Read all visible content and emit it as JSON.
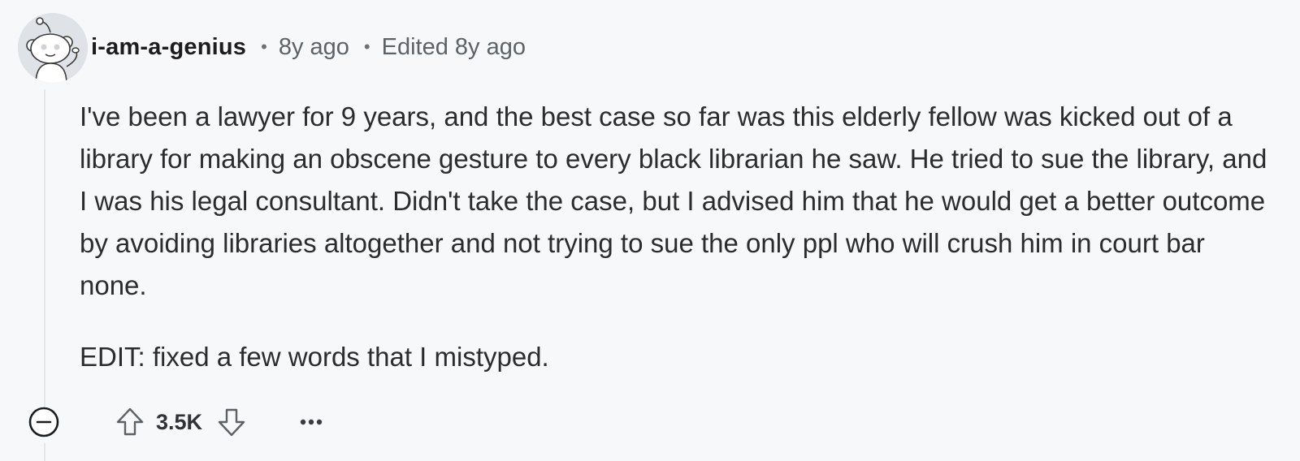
{
  "comment": {
    "author": "i-am-a-genius",
    "separator": "•",
    "age": "8y ago",
    "edited": "Edited 8y ago",
    "body_paragraphs": [
      "I've been a lawyer for 9 years, and the best case so far was this elderly fellow was kicked out of a library for making an obscene gesture to every black librarian he saw. He tried to sue the library, and I was his legal consultant. Didn't take the case, but I advised him that he would get a better outcome by avoiding libraries altogether and not trying to sue the only ppl who will crush him in court bar none.",
      "EDIT: fixed a few words that I mistyped."
    ],
    "score": "3.5K",
    "more_label": "•••"
  },
  "icons": {
    "avatar": "snoo-avatar-icon",
    "collapse": "collapse-minus-icon",
    "upvote": "upvote-arrow-icon",
    "downvote": "downvote-arrow-icon",
    "more": "more-options-icon"
  },
  "colors": {
    "background": "#f7f8fa",
    "text": "#2a2c2e",
    "meta": "#5c6266",
    "thread_line": "#e4e6e9"
  }
}
